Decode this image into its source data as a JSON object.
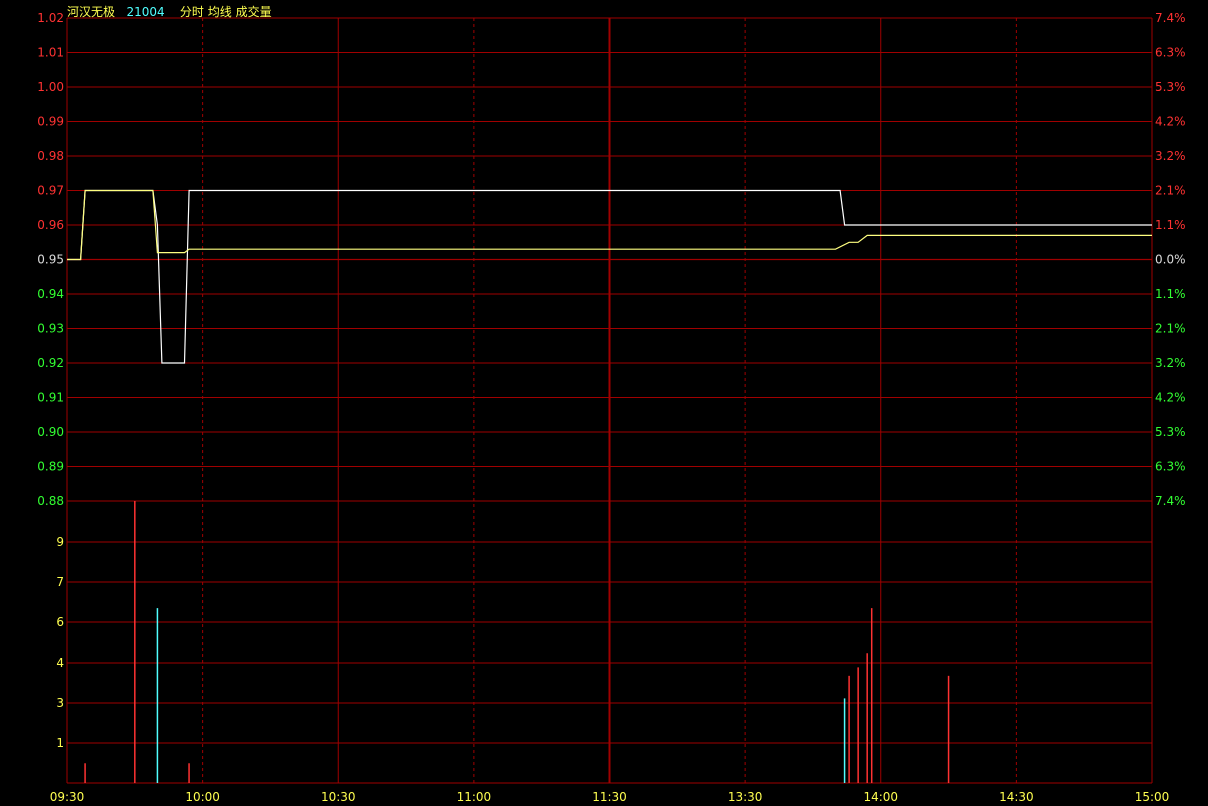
{
  "header": {
    "stock_name": "河汉无极",
    "stock_code": "21004",
    "view_label": "分时",
    "avg_label": "均线",
    "volume_label": "成交量"
  },
  "colors": {
    "background": "#000000",
    "grid": "#a00000",
    "up": "#ff3232",
    "down": "#32ff32",
    "neutral": "#dcdcdc",
    "volume_axis": "#ffff50",
    "time_axis": "#ffff50",
    "price_line": "#ffffff",
    "avg_line": "#ffff80",
    "volume_up": "#ff3232",
    "volume_down": "#50ffff",
    "stock_name": "#ffff50",
    "stock_code": "#50ffff",
    "header_text": "#ffffff"
  },
  "chart_data": {
    "type": "line",
    "subtype": "intraday-timeshare",
    "x_ticks": [
      "09:30",
      "10:00",
      "10:30",
      "11:00",
      "11:30",
      "13:30",
      "14:00",
      "14:30",
      "15:00"
    ],
    "preclose": 0.95,
    "price_ticks": [
      "1.02",
      "1.01",
      "1.00",
      "0.99",
      "0.98",
      "0.97",
      "0.96",
      "0.95",
      "0.94",
      "0.93",
      "0.92",
      "0.91",
      "0.90",
      "0.89",
      "0.88"
    ],
    "pct_ticks": [
      "7.4%",
      "6.3%",
      "5.3%",
      "4.2%",
      "3.2%",
      "2.1%",
      "1.1%",
      "0.0%",
      "1.1%",
      "2.1%",
      "3.2%",
      "4.2%",
      "5.3%",
      "6.3%",
      "7.4%"
    ],
    "price_ylim": [
      0.88,
      1.02
    ],
    "volume_ticks": [
      "9",
      "7",
      "6",
      "4",
      "3",
      "1"
    ],
    "volume_ylim": [
      0,
      10
    ],
    "series": [
      {
        "name": "分时",
        "points": [
          [
            "09:30",
            0.95
          ],
          [
            "09:33",
            0.95
          ],
          [
            "09:34",
            0.97
          ],
          [
            "09:49",
            0.97
          ],
          [
            "09:50",
            0.96
          ],
          [
            "09:51",
            0.92
          ],
          [
            "09:56",
            0.92
          ],
          [
            "09:57",
            0.97
          ],
          [
            "13:51",
            0.97
          ],
          [
            "13:52",
            0.96
          ],
          [
            "15:00",
            0.96
          ]
        ]
      },
      {
        "name": "均线",
        "points": [
          [
            "09:30",
            0.95
          ],
          [
            "09:33",
            0.95
          ],
          [
            "09:34",
            0.97
          ],
          [
            "09:49",
            0.97
          ],
          [
            "09:50",
            0.952
          ],
          [
            "09:56",
            0.952
          ],
          [
            "09:57",
            0.953
          ],
          [
            "13:50",
            0.953
          ],
          [
            "13:53",
            0.955
          ],
          [
            "13:55",
            0.955
          ],
          [
            "13:57",
            0.957
          ],
          [
            "14:15",
            0.957
          ],
          [
            "14:16",
            0.957
          ],
          [
            "15:00",
            0.957
          ]
        ]
      }
    ],
    "volume": [
      {
        "time": "09:34",
        "value": 0.7,
        "dir": "up"
      },
      {
        "time": "09:45",
        "value": 10,
        "dir": "up"
      },
      {
        "time": "09:50",
        "value": 6.2,
        "dir": "down"
      },
      {
        "time": "09:57",
        "value": 0.7,
        "dir": "up"
      },
      {
        "time": "13:52",
        "value": 3,
        "dir": "down"
      },
      {
        "time": "13:53",
        "value": 3.8,
        "dir": "up"
      },
      {
        "time": "13:55",
        "value": 4.1,
        "dir": "up"
      },
      {
        "time": "13:57",
        "value": 4.6,
        "dir": "up"
      },
      {
        "time": "13:58",
        "value": 6.2,
        "dir": "up"
      },
      {
        "time": "14:15",
        "value": 3.8,
        "dir": "up"
      }
    ]
  }
}
